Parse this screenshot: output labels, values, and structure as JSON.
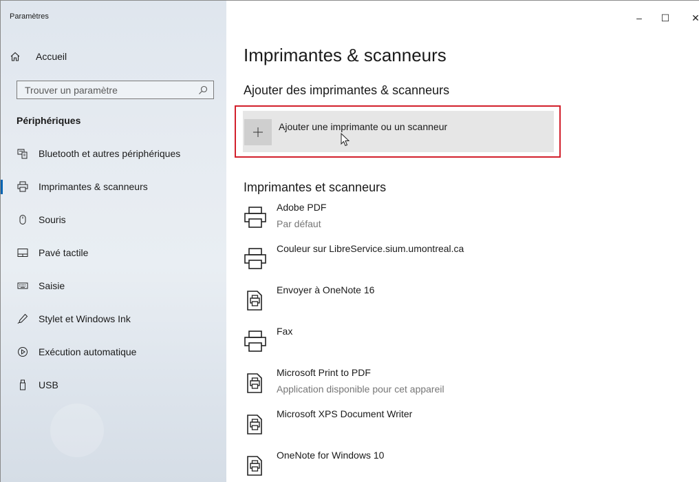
{
  "window": {
    "app_title": "Paramètres",
    "minimize_glyph": "–",
    "maximize_glyph": "☐",
    "close_glyph": "✕"
  },
  "sidebar": {
    "home_label": "Accueil",
    "search_placeholder": "Trouver un paramètre",
    "section_heading": "Périphériques",
    "items": [
      {
        "label": "Bluetooth et autres périphériques",
        "icon": "bluetooth-devices-icon"
      },
      {
        "label": "Imprimantes & scanneurs",
        "icon": "printer-icon",
        "selected": true
      },
      {
        "label": "Souris",
        "icon": "mouse-icon"
      },
      {
        "label": "Pavé tactile",
        "icon": "touchpad-icon"
      },
      {
        "label": "Saisie",
        "icon": "keyboard-icon"
      },
      {
        "label": "Stylet et Windows Ink",
        "icon": "pen-icon"
      },
      {
        "label": "Exécution automatique",
        "icon": "autoplay-icon"
      },
      {
        "label": "USB",
        "icon": "usb-icon"
      }
    ]
  },
  "main": {
    "title": "Imprimantes & scanneurs",
    "add_section_heading": "Ajouter des imprimantes & scanneurs",
    "add_button_label": "Ajouter une imprimante ou un scanneur",
    "list_heading": "Imprimantes et scanneurs",
    "printers": [
      {
        "name": "Adobe PDF",
        "sub": "Par défaut",
        "icon": "printer-icon"
      },
      {
        "name": "Couleur sur LibreService.sium.umontreal.ca",
        "sub": "",
        "icon": "printer-icon"
      },
      {
        "name": "Envoyer à OneNote 16",
        "sub": "",
        "icon": "document-printer-icon"
      },
      {
        "name": "Fax",
        "sub": "",
        "icon": "printer-icon"
      },
      {
        "name": "Microsoft Print to PDF",
        "sub": "Application disponible pour cet appareil",
        "icon": "document-printer-icon"
      },
      {
        "name": "Microsoft XPS Document Writer",
        "sub": "",
        "icon": "document-printer-icon"
      },
      {
        "name": "OneNote for Windows 10",
        "sub": "",
        "icon": "document-printer-icon"
      }
    ]
  },
  "colors": {
    "accent": "#0063b1",
    "highlight_border": "#d21f2b",
    "secondary_text": "#767676"
  }
}
